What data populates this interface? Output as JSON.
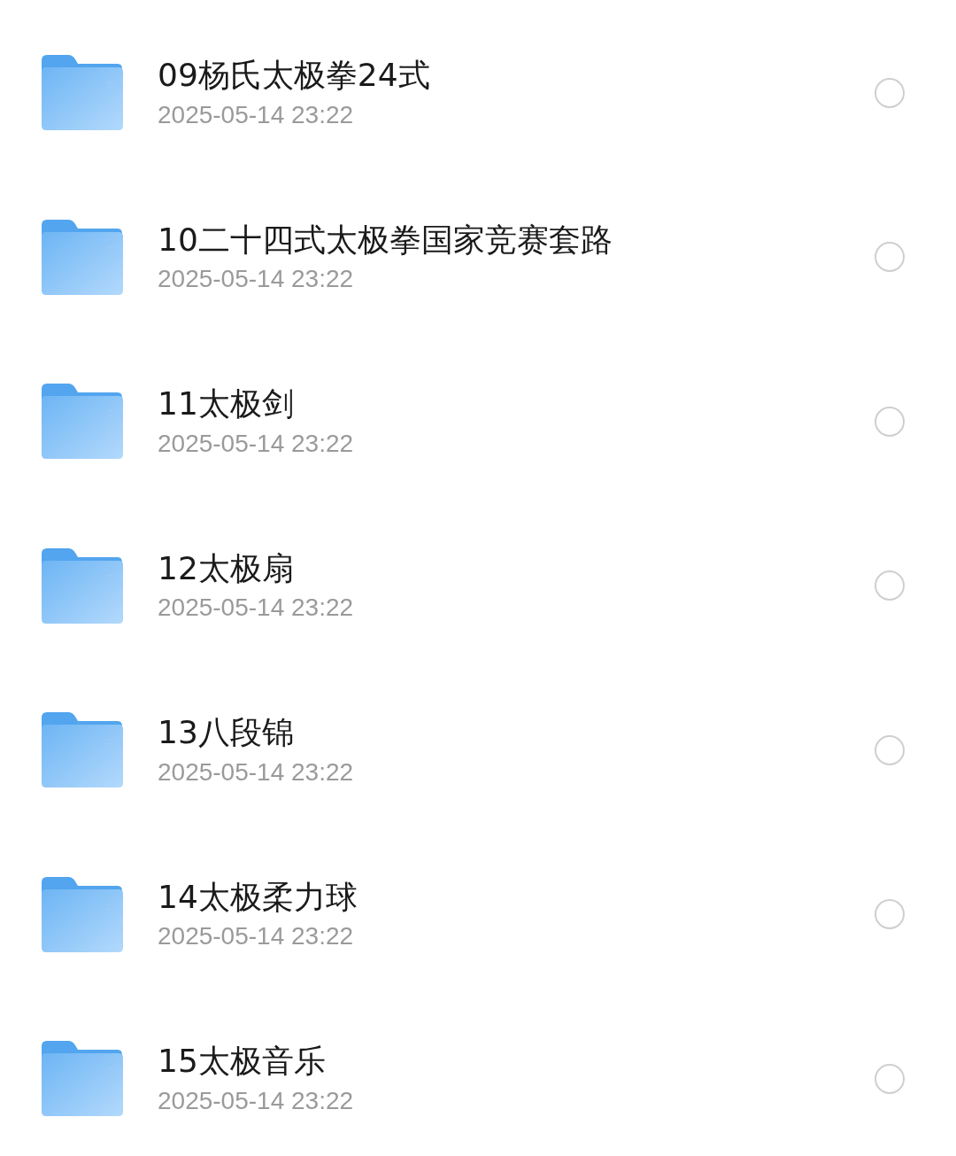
{
  "files": [
    {
      "name": "09杨氏太极拳24式",
      "date": "2025-05-14 23:22",
      "selected": false
    },
    {
      "name": "10二十四式太极拳国家竞赛套路",
      "date": "2025-05-14 23:22",
      "selected": false
    },
    {
      "name": "11太极剑",
      "date": "2025-05-14 23:22",
      "selected": false
    },
    {
      "name": "12太极扇",
      "date": "2025-05-14 23:22",
      "selected": false
    },
    {
      "name": "13八段锦",
      "date": "2025-05-14 23:22",
      "selected": false
    },
    {
      "name": "14太极柔力球",
      "date": "2025-05-14 23:22",
      "selected": false
    },
    {
      "name": "15太极音乐",
      "date": "2025-05-14 23:22",
      "selected": false
    }
  ]
}
